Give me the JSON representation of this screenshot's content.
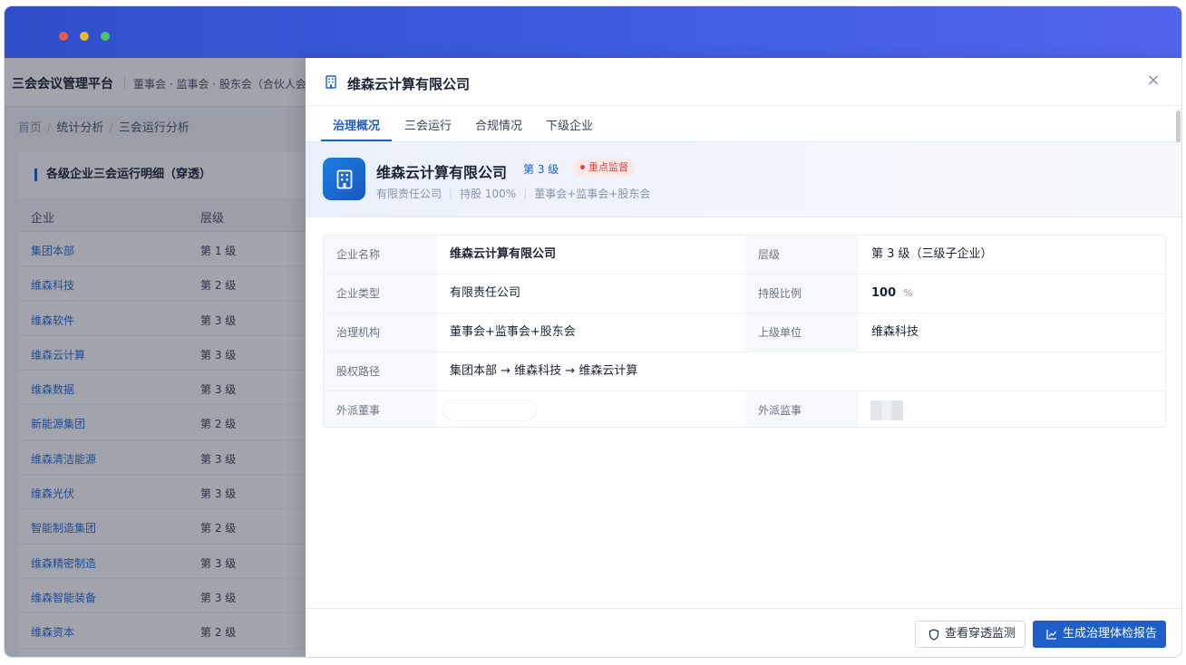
{
  "app": {
    "brand": "三会会议管理平台",
    "brand_sub": "董事会 · 监事会 · 股东会（合伙人会",
    "breadcrumb": [
      "首页",
      "统计分析",
      "三会运行分析"
    ]
  },
  "list_card": {
    "title": "各级企业三会运行明细（穿透）",
    "columns": [
      "企业",
      "层级"
    ],
    "rows": [
      {
        "name": "集团本部",
        "level": "第 1 级"
      },
      {
        "name": "维森科技",
        "level": "第 2 级"
      },
      {
        "name": "维森软件",
        "level": "第 3 级"
      },
      {
        "name": "维森云计算",
        "level": "第 3 级"
      },
      {
        "name": "维森数据",
        "level": "第 3 级"
      },
      {
        "name": "新能源集团",
        "level": "第 2 级"
      },
      {
        "name": "维森清洁能源",
        "level": "第 3 级"
      },
      {
        "name": "维森光伏",
        "level": "第 3 级"
      },
      {
        "name": "智能制造集团",
        "level": "第 2 级"
      },
      {
        "name": "维森精密制造",
        "level": "第 3 级"
      },
      {
        "name": "维森智能装备",
        "level": "第 3 级"
      },
      {
        "name": "维森资本",
        "level": "第 2 级"
      }
    ]
  },
  "drawer": {
    "title": "维森云计算有限公司",
    "close_label": "×",
    "tabs": [
      "治理概况",
      "三会运行",
      "合规情况",
      "下级企业"
    ],
    "active_tab": 0,
    "summary": {
      "name": "维森云计算有限公司",
      "level": "第 3 级",
      "badge": "重点监督",
      "meta": [
        "有限责任公司",
        "持股 100%",
        "董事会+监事会+股东会"
      ]
    },
    "info": {
      "company_name_label": "企业名称",
      "company_name": "维森云计算有限公司",
      "level_label": "层级",
      "level": "第 3 级（三级子企业）",
      "type_label": "企业类型",
      "type": "有限责任公司",
      "share_label": "持股比例",
      "share": "100",
      "share_unit": "%",
      "gov_label": "治理机构",
      "gov": "董事会+监事会+股东会",
      "parent_label": "上级单位",
      "parent": "维森科技",
      "path_label": "股权路径",
      "path": "集团本部 → 维森科技 → 维森云计算",
      "ext_director_label": "外派董事",
      "ext_supervisor_label": "外派监事"
    },
    "buttons": {
      "monitor": "查看穿透监测",
      "report": "生成治理体检报告"
    }
  },
  "colors": {
    "primary": "#1f5fc9",
    "danger": "#e04545",
    "titlebar_start": "#2f4fc9",
    "titlebar_end": "#5165ec"
  },
  "icons": {
    "header": "building-icon",
    "avatar": "building-icon",
    "close": "close-icon",
    "monitor": "shield-icon",
    "report": "line-chart-icon"
  }
}
